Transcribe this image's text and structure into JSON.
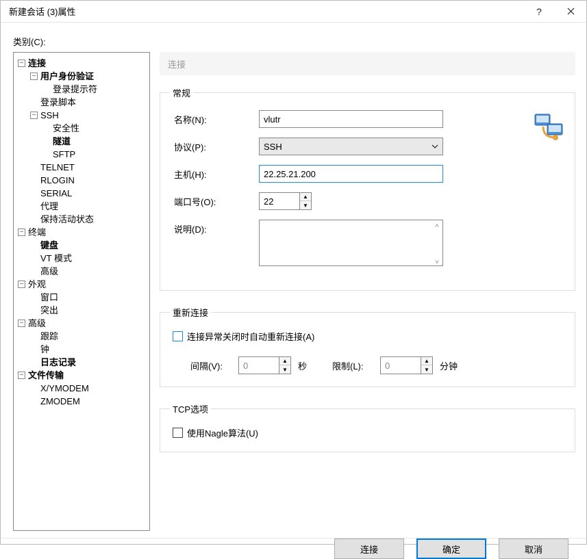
{
  "window": {
    "title": "新建会话 (3)属性"
  },
  "categoryLabel": "类别(C):",
  "tree": [
    {
      "indent": 0,
      "toggle": "−",
      "label": "连接",
      "bold": true
    },
    {
      "indent": 1,
      "toggle": "−",
      "label": "用户身份验证",
      "bold": true
    },
    {
      "indent": 2,
      "toggle": "",
      "label": "登录提示符",
      "bold": false
    },
    {
      "indent": 1,
      "toggle": "",
      "label": "登录脚本",
      "bold": false
    },
    {
      "indent": 1,
      "toggle": "−",
      "label": "SSH",
      "bold": false
    },
    {
      "indent": 2,
      "toggle": "",
      "label": "安全性",
      "bold": false
    },
    {
      "indent": 2,
      "toggle": "",
      "label": "隧道",
      "bold": true
    },
    {
      "indent": 2,
      "toggle": "",
      "label": "SFTP",
      "bold": false
    },
    {
      "indent": 1,
      "toggle": "",
      "label": "TELNET",
      "bold": false
    },
    {
      "indent": 1,
      "toggle": "",
      "label": "RLOGIN",
      "bold": false
    },
    {
      "indent": 1,
      "toggle": "",
      "label": "SERIAL",
      "bold": false
    },
    {
      "indent": 1,
      "toggle": "",
      "label": "代理",
      "bold": false
    },
    {
      "indent": 1,
      "toggle": "",
      "label": "保持活动状态",
      "bold": false
    },
    {
      "indent": 0,
      "toggle": "−",
      "label": "终端",
      "bold": false
    },
    {
      "indent": 1,
      "toggle": "",
      "label": "键盘",
      "bold": true
    },
    {
      "indent": 1,
      "toggle": "",
      "label": "VT 模式",
      "bold": false
    },
    {
      "indent": 1,
      "toggle": "",
      "label": "高级",
      "bold": false
    },
    {
      "indent": 0,
      "toggle": "−",
      "label": "外观",
      "bold": false
    },
    {
      "indent": 1,
      "toggle": "",
      "label": "窗口",
      "bold": false
    },
    {
      "indent": 1,
      "toggle": "",
      "label": "突出",
      "bold": false
    },
    {
      "indent": 0,
      "toggle": "−",
      "label": "高级",
      "bold": false
    },
    {
      "indent": 1,
      "toggle": "",
      "label": "跟踪",
      "bold": false
    },
    {
      "indent": 1,
      "toggle": "",
      "label": "钟",
      "bold": false
    },
    {
      "indent": 1,
      "toggle": "",
      "label": "日志记录",
      "bold": true
    },
    {
      "indent": 0,
      "toggle": "−",
      "label": "文件传输",
      "bold": true
    },
    {
      "indent": 1,
      "toggle": "",
      "label": "X/YMODEM",
      "bold": false
    },
    {
      "indent": 1,
      "toggle": "",
      "label": "ZMODEM",
      "bold": false
    }
  ],
  "sectionHeader": "连接",
  "groups": {
    "general": {
      "legend": "常规",
      "name": {
        "label": "名称(N):",
        "value": "vlutr"
      },
      "protocol": {
        "label": "协议(P):",
        "value": "SSH"
      },
      "host": {
        "label": "主机(H):",
        "value": "22.25.21.200"
      },
      "port": {
        "label": "端口号(O):",
        "value": "22"
      },
      "desc": {
        "label": "说明(D):",
        "value": ""
      }
    },
    "reconnect": {
      "legend": "重新连接",
      "checkbox": "连接异常关闭时自动重新连接(A)",
      "interval": {
        "label": "间隔(V):",
        "value": "0",
        "unit": "秒"
      },
      "limit": {
        "label": "限制(L):",
        "value": "0",
        "unit": "分钟"
      }
    },
    "tcp": {
      "legend": "TCP选项",
      "nagle": "使用Nagle算法(U)"
    }
  },
  "footer": {
    "connect": "连接",
    "ok": "确定",
    "cancel": "取消"
  }
}
